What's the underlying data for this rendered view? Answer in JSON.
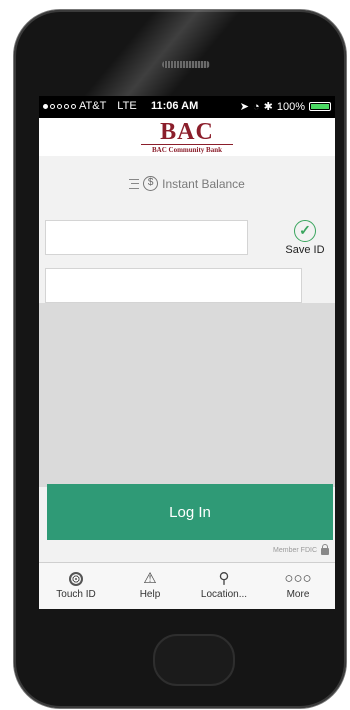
{
  "status_bar": {
    "signal_filled": 1,
    "signal_total": 5,
    "carrier": "AT&T",
    "network": "LTE",
    "time": "11:06 AM",
    "battery": "100%",
    "battery_level": 1.0,
    "battery_color": "#4cd964"
  },
  "header": {
    "logo_text": "BAC",
    "logo_subtitle": "BAC Community Bank",
    "brand_color": "#8b1e2b"
  },
  "instant_balance": {
    "icon": "dollar-coin-icon",
    "label": "Instant Balance"
  },
  "login_form": {
    "username_value": "",
    "password_value": "",
    "save_id_label": "Save ID",
    "save_id_checked": true,
    "login_button": "Log In",
    "accent_color": "#2f9a76"
  },
  "footer": {
    "member_fdic": "Member FDIC"
  },
  "tab_bar": {
    "items": [
      {
        "label": "Touch ID",
        "icon": "fingerprint-icon"
      },
      {
        "label": "Help",
        "icon": "warning-icon"
      },
      {
        "label": "Location...",
        "icon": "location-pin-icon"
      },
      {
        "label": "More",
        "icon": "more-dots-icon"
      }
    ]
  }
}
